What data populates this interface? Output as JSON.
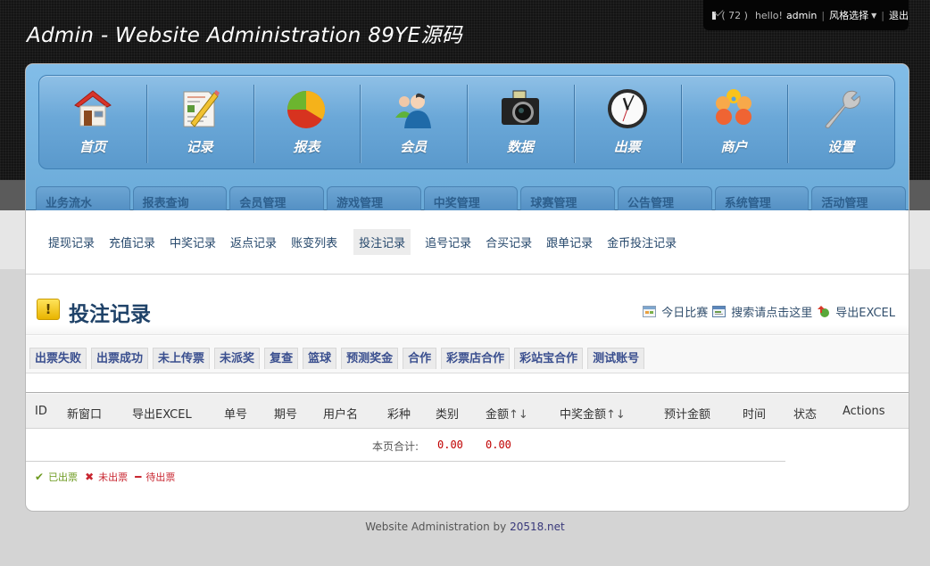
{
  "header": {
    "title": "Admin - Website Administration 89YE源码"
  },
  "user_bar": {
    "mail_icon": "envelope-icon",
    "message_count": "( 72 )",
    "greeting": "hello!",
    "username": "admin",
    "style_label": "风格选择",
    "logout_label": "退出"
  },
  "icon_nav": [
    {
      "label": "首页",
      "icon": "home-icon"
    },
    {
      "label": "记录",
      "icon": "document-edit-icon"
    },
    {
      "label": "报表",
      "icon": "pie-chart-icon"
    },
    {
      "label": "会员",
      "icon": "users-icon"
    },
    {
      "label": "数据",
      "icon": "camera-icon"
    },
    {
      "label": "出票",
      "icon": "clock-icon"
    },
    {
      "label": "商户",
      "icon": "merchant-icon"
    },
    {
      "label": "设置",
      "icon": "wrench-icon"
    }
  ],
  "tabs": [
    {
      "label": "业务流水"
    },
    {
      "label": "报表查询"
    },
    {
      "label": "会员管理"
    },
    {
      "label": "游戏管理"
    },
    {
      "label": "中奖管理"
    },
    {
      "label": "球赛管理"
    },
    {
      "label": "公告管理"
    },
    {
      "label": "系统管理"
    },
    {
      "label": "活动管理"
    }
  ],
  "sub_nav": [
    {
      "label": "提现记录",
      "active": false
    },
    {
      "label": "充值记录",
      "active": false
    },
    {
      "label": "中奖记录",
      "active": false
    },
    {
      "label": "返点记录",
      "active": false
    },
    {
      "label": "账变列表",
      "active": false
    },
    {
      "label": "投注记录",
      "active": true
    },
    {
      "label": "追号记录",
      "active": false
    },
    {
      "label": "合买记录",
      "active": false
    },
    {
      "label": "跟单记录",
      "active": false
    },
    {
      "label": "金币投注记录",
      "active": false
    }
  ],
  "page": {
    "title": "投注记录",
    "title_icon": "warning-icon",
    "actions": [
      {
        "label": "今日比赛",
        "icon": "calendar-icon"
      },
      {
        "label": "搜索请点击这里",
        "icon": "search-window-icon"
      },
      {
        "label": "导出EXCEL",
        "icon": "export-icon"
      }
    ]
  },
  "filters": [
    "出票失败",
    "出票成功",
    "未上传票",
    "未派奖",
    "复查",
    "篮球",
    "预测奖金",
    "合作",
    "彩票店合作",
    "彩站宝合作",
    "测试账号"
  ],
  "table": {
    "columns": [
      {
        "label": "ID",
        "sortable": false
      },
      {
        "label": "新窗口",
        "sortable": false
      },
      {
        "label": "导出EXCEL",
        "sortable": false
      },
      {
        "label": "单号",
        "sortable": false
      },
      {
        "label": "期号",
        "sortable": false
      },
      {
        "label": "用户名",
        "sortable": false
      },
      {
        "label": "彩种",
        "sortable": false
      },
      {
        "label": "类别",
        "sortable": false
      },
      {
        "label": "金额",
        "sortable": true,
        "arrows": "↑↓"
      },
      {
        "label": "中奖金额",
        "sortable": true,
        "arrows": "↑↓"
      },
      {
        "label": "预计金额",
        "sortable": false
      },
      {
        "label": "时间",
        "sortable": false
      },
      {
        "label": "状态",
        "sortable": false
      },
      {
        "label": "Actions",
        "sortable": false
      }
    ],
    "rows": [],
    "summary": {
      "label": "本页合计:",
      "amount": "0.00",
      "win_amount": "0.00"
    }
  },
  "legend": [
    {
      "label": "已出票",
      "icon": "check-icon",
      "glyph": "✔"
    },
    {
      "label": "未出票",
      "icon": "cross-icon",
      "glyph": "✖"
    },
    {
      "label": "待出票",
      "icon": "minus-icon",
      "glyph": "━"
    }
  ],
  "footer": {
    "text": "Website Administration by",
    "link": "20518.net"
  },
  "colors": {
    "accent_blue": "#6aaad8",
    "title_blue": "#1f4268",
    "amount_red": "#c00000",
    "ok_green": "#6c9a1f"
  }
}
